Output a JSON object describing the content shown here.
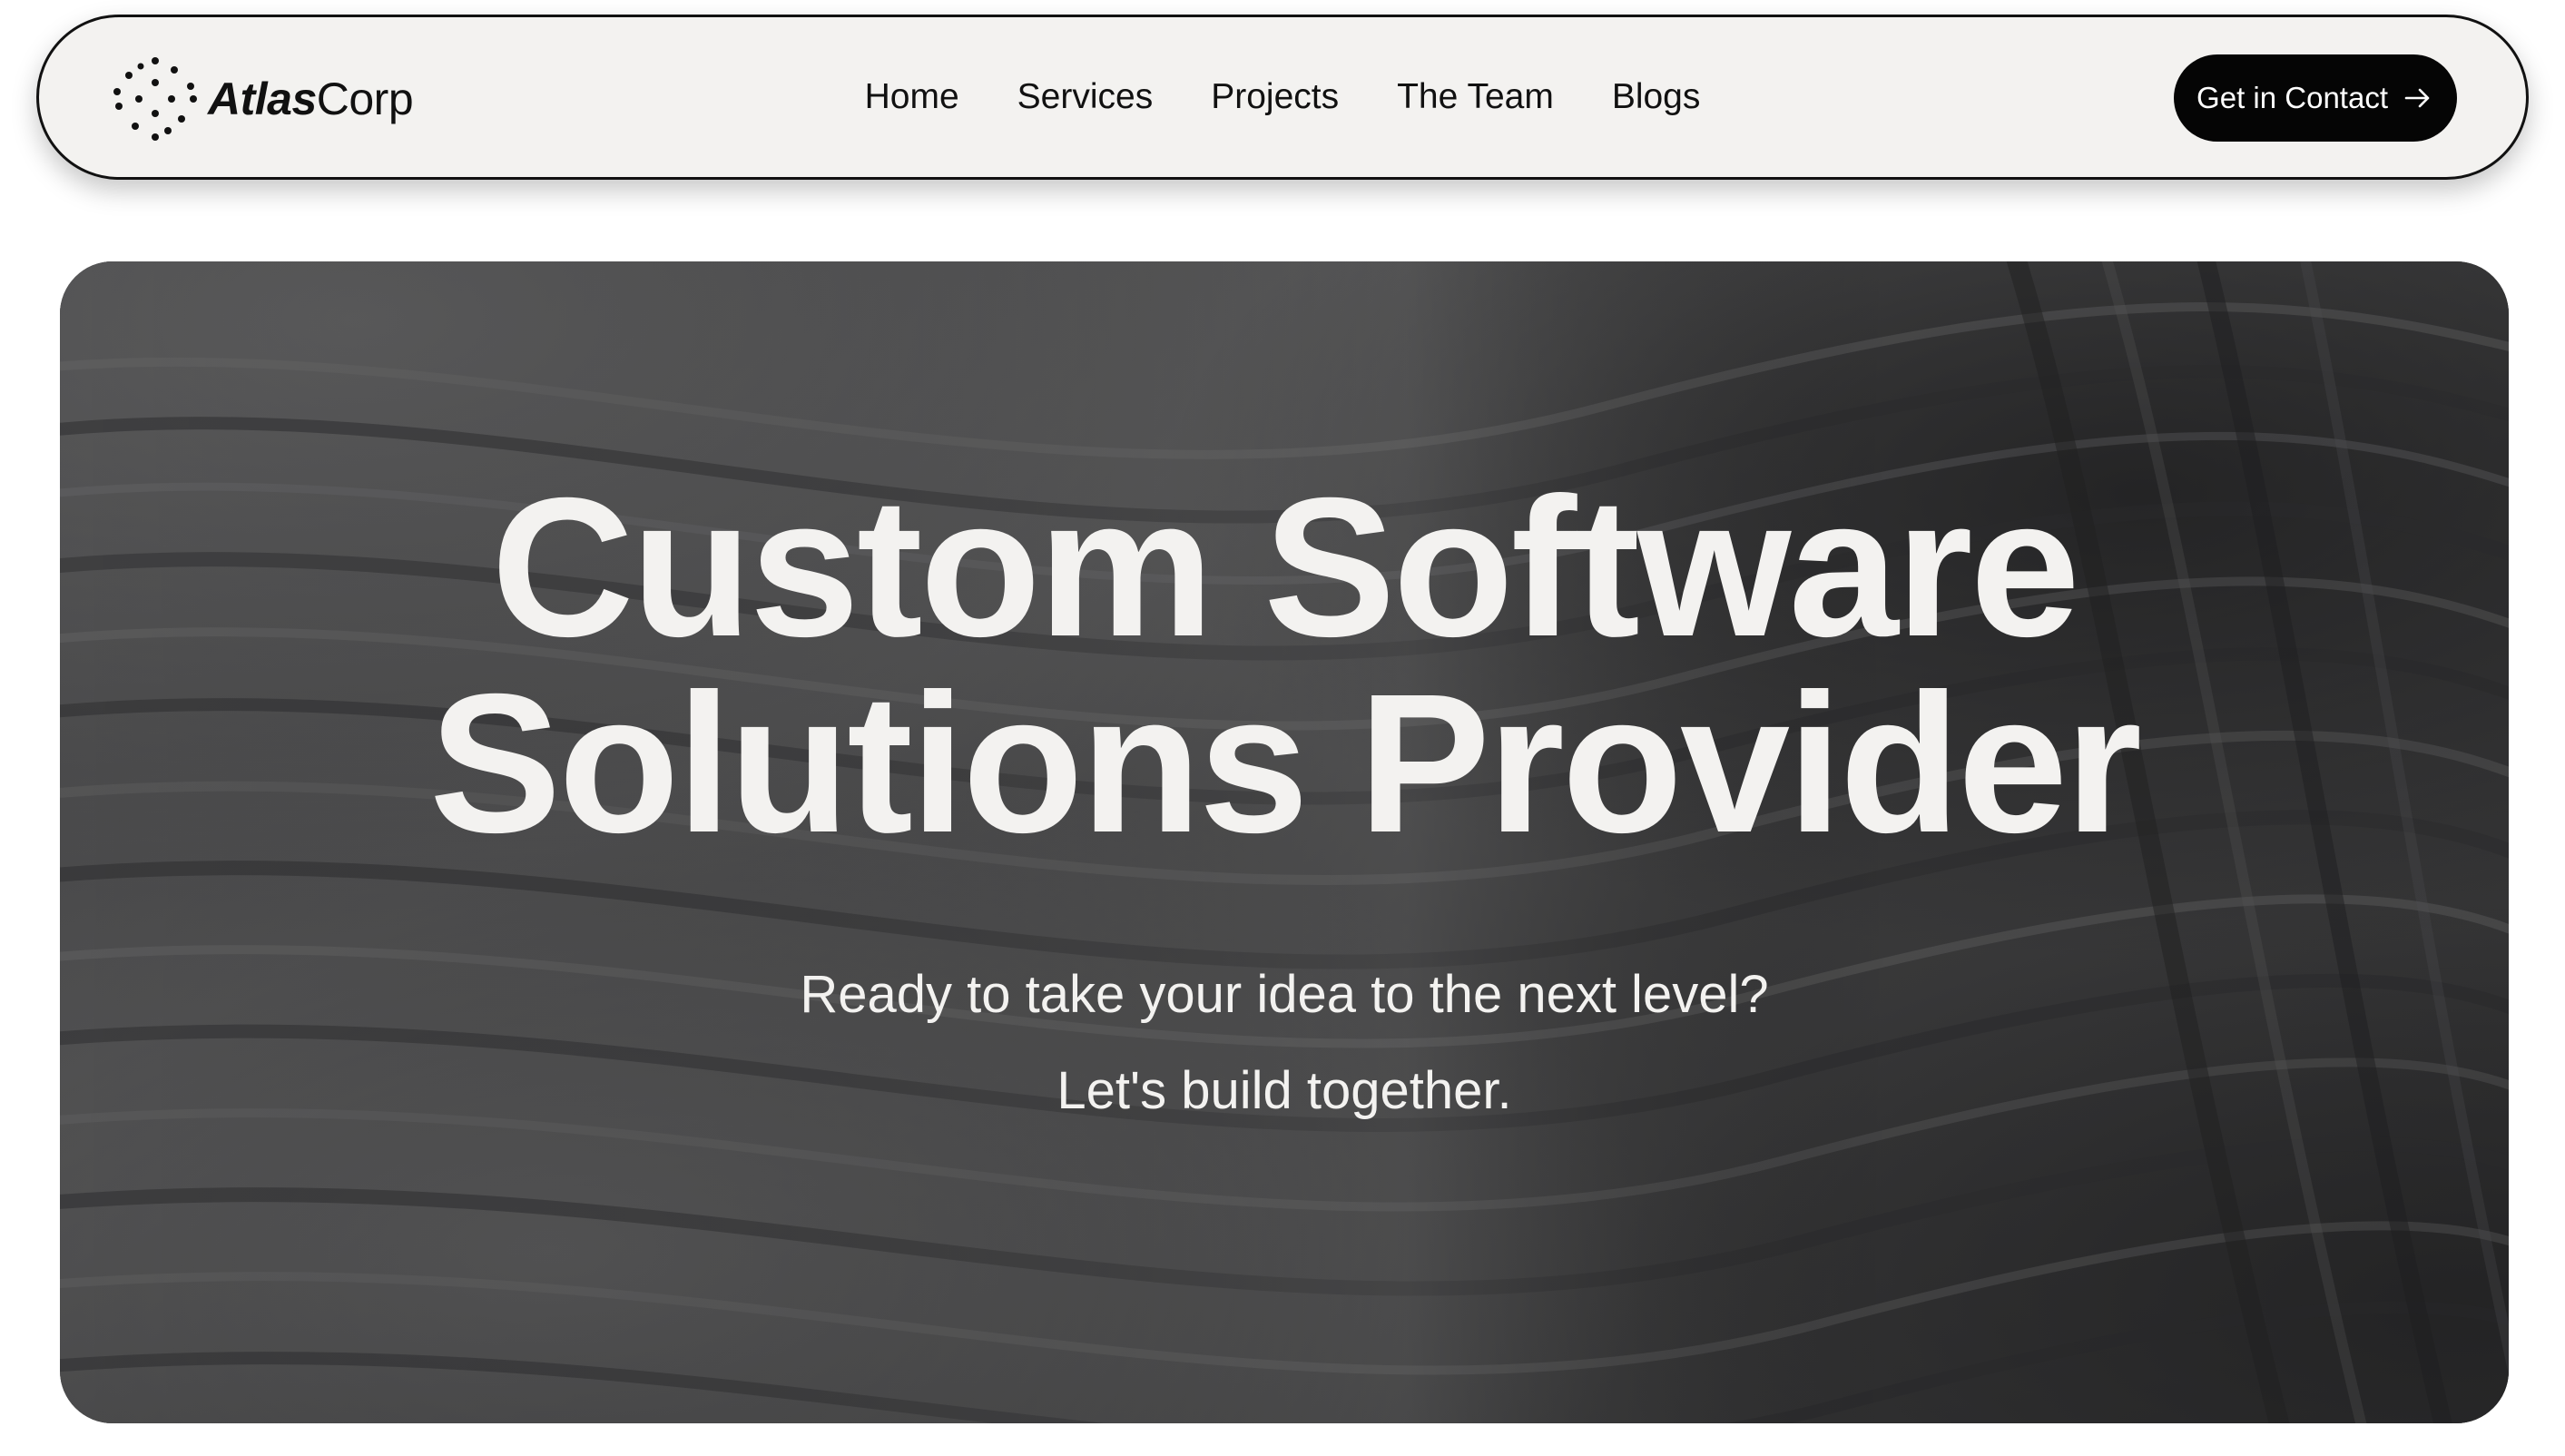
{
  "brand": {
    "name_bold": "Atlas",
    "name_light": "Corp",
    "logo_icon": "dotted-diamond-icon"
  },
  "nav": {
    "items": [
      {
        "label": "Home"
      },
      {
        "label": "Services"
      },
      {
        "label": "Projects"
      },
      {
        "label": "The Team"
      },
      {
        "label": "Blogs"
      }
    ],
    "cta": {
      "label": "Get in Contact",
      "icon": "arrow-right-icon"
    }
  },
  "hero": {
    "title_line_1": "Custom Software",
    "title_line_2": "Solutions Provider",
    "subtitle_line_1": "Ready to take your idea to the next level?",
    "subtitle_line_2": "Let's build together."
  },
  "colors": {
    "nav_background": "#f3f2f0",
    "nav_border": "#111111",
    "cta_background": "#050505",
    "cta_text": "#ffffff",
    "hero_background": "#3b3b3c",
    "hero_text": "#f3f2f0"
  }
}
